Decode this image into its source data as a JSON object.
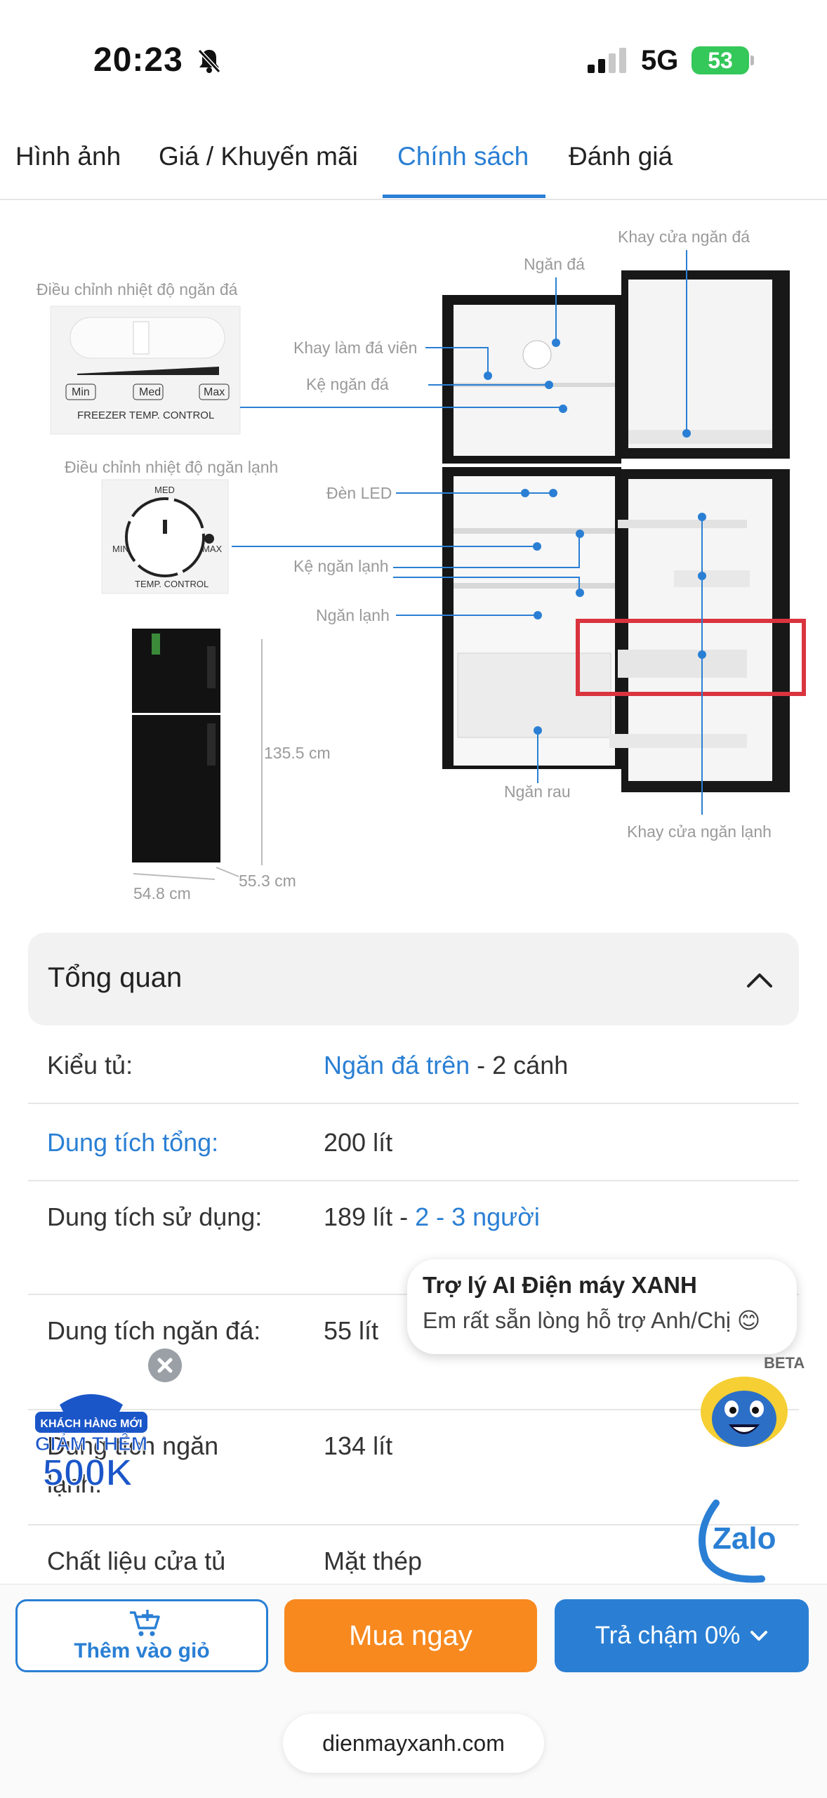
{
  "status_bar": {
    "time": "20:23",
    "network": "5G",
    "battery": "53"
  },
  "tabs": [
    {
      "label": "Hình ảnh",
      "active": false
    },
    {
      "label": "Giá / Khuyến mãi",
      "active": false
    },
    {
      "label": "Chính sách",
      "active": true
    },
    {
      "label": "Đánh giá",
      "active": false
    }
  ],
  "product_image": {
    "freezer_control_title": "Điều chỉnh nhiệt độ ngăn đá",
    "freezer_control_panel": {
      "min": "Min",
      "med": "Med",
      "max": "Max",
      "caption": "FREEZER TEMP. CONTROL"
    },
    "fridge_control_title": "Điều chỉnh nhiệt độ ngăn lạnh",
    "fridge_control_dial": {
      "med": "MED",
      "min": "MIN",
      "max": "MAX",
      "caption": "TEMP. CONTROL"
    },
    "callouts": {
      "freezer_door_tray": "Khay cửa ngăn đá",
      "freezer": "Ngăn đá",
      "ice_tray": "Khay làm đá viên",
      "freezer_shelf": "Kệ ngăn đá",
      "led": "Đèn LED",
      "fridge_shelf": "Kệ ngăn lạnh",
      "fridge": "Ngăn lạnh",
      "crisper": "Ngăn rau",
      "fridge_door_tray": "Khay cửa ngăn lạnh"
    },
    "dimensions": {
      "height": "135.5 cm",
      "width": "54.8 cm",
      "depth": "55.3 cm"
    },
    "highlight_color": "#d9343f"
  },
  "overview": {
    "title": "Tổng quan",
    "expanded": true
  },
  "specs": [
    {
      "label": "Kiểu tủ:",
      "label_link": false,
      "value_link": "Ngăn đá trên",
      "value_text": " - 2 cánh"
    },
    {
      "label": "Dung tích tổng:",
      "label_link": true,
      "value_link": "",
      "value_text": "200 lít"
    },
    {
      "label": "Dung tích sử dụng:",
      "label_link": false,
      "value_link": "2 - 3 người",
      "value_text": "189 lít - "
    },
    {
      "label": "Dung tích ngăn đá:",
      "label_link": false,
      "value_link": "",
      "value_text": "55 lít"
    },
    {
      "label": "Dung tích ngăn lạnh:",
      "label_link": false,
      "value_link": "",
      "value_text": "134 lít"
    },
    {
      "label": "Chất liệu cửa tủ",
      "label_link": false,
      "value_link": "",
      "value_text": "Mặt thép"
    }
  ],
  "ai_assistant": {
    "title": "Trợ lý AI Điện máy XANH",
    "subtitle": "Em rất sẵn lòng hỗ trợ Anh/Chị 😊",
    "badge": "BETA"
  },
  "promo": {
    "line1": "KHÁCH HÀNG MỚI",
    "line2": "GIẢM THÊM",
    "line3": "500K"
  },
  "zalo": {
    "label": "Zalo"
  },
  "bottom_bar": {
    "add_to_cart": "Thêm vào giỏ",
    "buy_now": "Mua ngay",
    "installment": "Trả chậm 0%"
  },
  "url": "dienmayxanh.com",
  "colors": {
    "accent": "#2a7fd4",
    "buy": "#f7891f",
    "battery": "#34c759"
  }
}
